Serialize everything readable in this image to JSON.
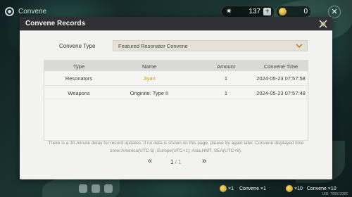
{
  "topbar": {
    "title": "Convene",
    "currency_1_value": "137",
    "currency_2_value": "0"
  },
  "modal": {
    "title": "Convene Records",
    "type_label": "Convene Type",
    "type_value": "Featured Resonator Convene"
  },
  "table": {
    "headers": [
      "Type",
      "Name",
      "Amount",
      "Convene Time"
    ],
    "rows": [
      {
        "type": "Resonators",
        "name": "Jiyan",
        "amount": "1",
        "time": "2024-05-23 07:57:58"
      },
      {
        "type": "Weapons",
        "name": "Originite: Type II",
        "amount": "1",
        "time": "2024-05-23 07:57:48"
      }
    ],
    "highlight_color": "#c89a12"
  },
  "note": "There is a 30-minute delay for record updates. If no data is shown on this page, please try again later. Convene displayed time zone:America(UTC-5); Europe(UTC+1); Asia,HMT, SEA(UTC+8).",
  "pager": {
    "prev": "«",
    "current": "1",
    "separator": "/",
    "total": "1",
    "next": "»"
  },
  "bottom": {
    "convene_1_label": "Convene ×1",
    "convene_1_cost": "×1",
    "convene_10_label": "Convene ×10",
    "convene_10_cost": "×10",
    "uid": "UID: 700013382"
  },
  "icons": {
    "settings": "gear-icon",
    "astrite": "astrite-icon",
    "lustrous_tide": "lustrous-tide-icon",
    "close": "close-icon",
    "dropdown": "chevron-down-icon"
  }
}
